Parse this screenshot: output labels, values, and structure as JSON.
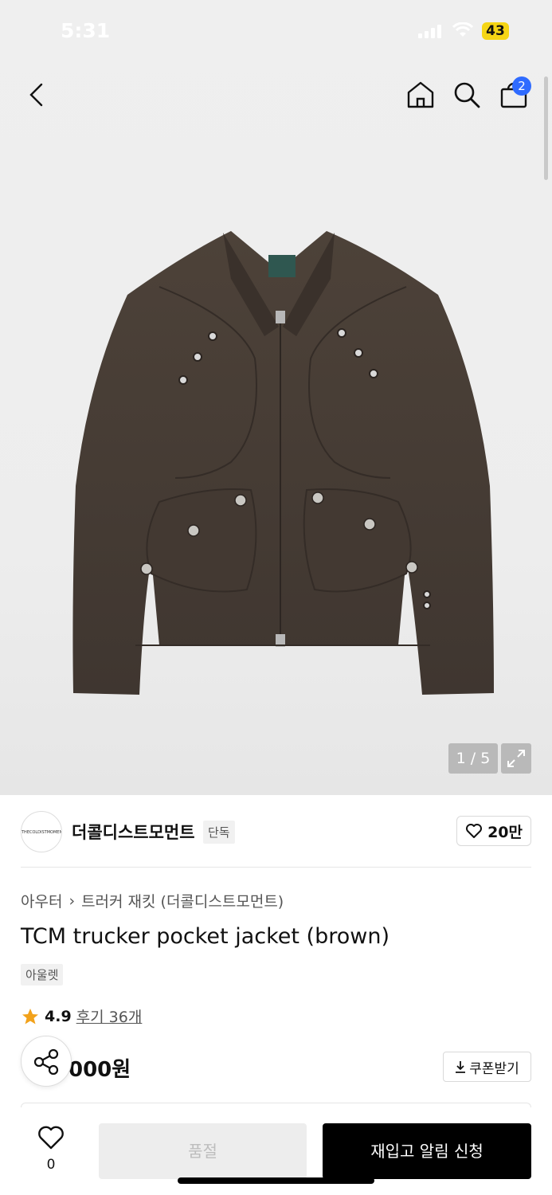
{
  "status_bar": {
    "time": "5:31",
    "battery": "43"
  },
  "header": {
    "cart_count": "2"
  },
  "gallery": {
    "pager": "1 / 5"
  },
  "brand": {
    "logo_text": "THECOLDISTMOMENT",
    "name": "더콜디스트모먼트",
    "tag": "단독",
    "likes": "20만"
  },
  "breadcrumb": {
    "category": "아우터",
    "separator": "›",
    "subcategory": "트러커 재킷 (더콜디스트모먼트)"
  },
  "product": {
    "title": "TCM trucker pocket jacket (brown)",
    "badge": "아울렛",
    "rating": "4.9",
    "reviews": "후기 36개",
    "price": "000원"
  },
  "coupon": {
    "label": "쿠폰받기"
  },
  "bottom": {
    "wish_count": "0",
    "soldout_label": "품절",
    "restock_label": "재입고 알림 신청"
  },
  "colors": {
    "accent": "#2f6bff",
    "jacket": "#4a4039",
    "star": "#f2a21b"
  }
}
